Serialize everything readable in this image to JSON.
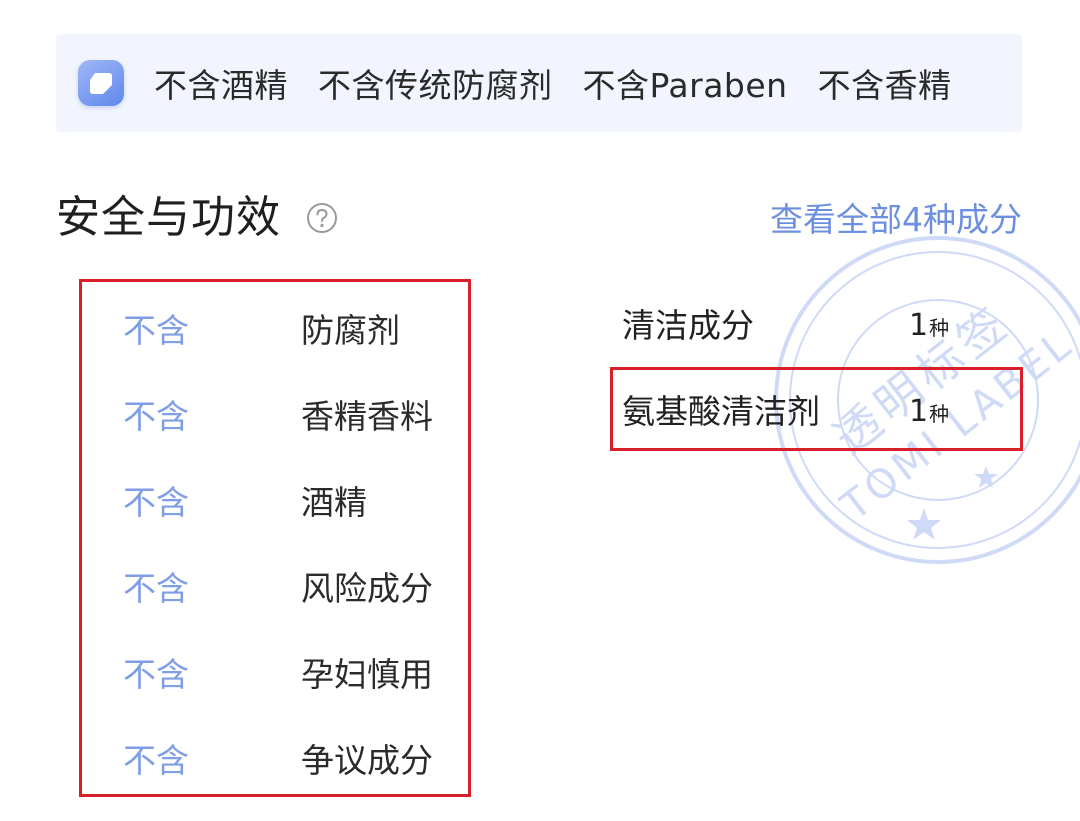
{
  "banner": {
    "icon": "tag-icon",
    "tags": [
      "不含酒精",
      "不含传统防腐剂",
      "不含Paraben",
      "不含香精"
    ]
  },
  "section": {
    "title": "安全与功效",
    "help_icon": "question-circle-icon",
    "view_all_label": "查看全部4种成分"
  },
  "safety_list": [
    {
      "status": "不含",
      "item": "防腐剂"
    },
    {
      "status": "不含",
      "item": "香精香料"
    },
    {
      "status": "不含",
      "item": "酒精"
    },
    {
      "status": "不含",
      "item": "风险成分"
    },
    {
      "status": "不含",
      "item": "孕妇慎用"
    },
    {
      "status": "不含",
      "item": "争议成分"
    }
  ],
  "ingredients": [
    {
      "name": "清洁成分",
      "count": "1",
      "unit": "种"
    },
    {
      "name": "氨基酸清洁剂",
      "count": "1",
      "unit": "种"
    }
  ],
  "stamp": {
    "text_cn": "透明标签",
    "text_en": "TOMI LABEL"
  },
  "colors": {
    "accent": "#6d8fdf",
    "highlight_border": "#d8202a",
    "banner_bg": "#f2f5fd"
  }
}
